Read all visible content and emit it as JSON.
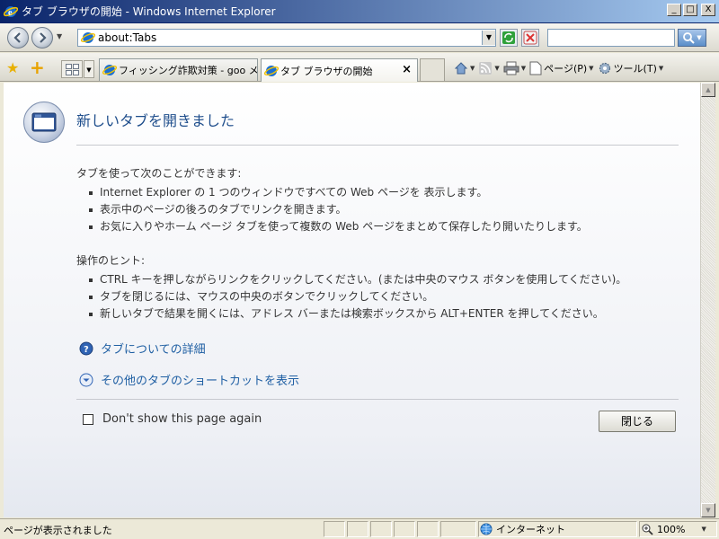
{
  "window": {
    "title": "タブ ブラウザの開始 - Windows Internet Explorer",
    "minimize": "_",
    "maximize": "□",
    "close": "X"
  },
  "address": {
    "url": "about:Tabs"
  },
  "tabs": [
    {
      "label": "フィッシング詐欺対策 - goo メ..."
    },
    {
      "label": "タブ ブラウザの開始",
      "close": "×"
    }
  ],
  "commandbar": {
    "page_label": "ページ(P)",
    "tools_label": "ツール(T)"
  },
  "content": {
    "heading": "新しいタブを開きました",
    "section1": {
      "title": "タブを使って次のことができます:",
      "items": [
        "Internet Explorer の 1 つのウィンドウですべての Web ページを 表示します。",
        "表示中のページの後ろのタブでリンクを開きます。",
        "お気に入りやホーム ページ タブを使って複数の Web ページをまとめて保存したり開いたりします。"
      ]
    },
    "section2": {
      "title": "操作のヒント:",
      "items": [
        "CTRL キーを押しながらリンクをクリックしてください。(または中央のマウス ボタンを使用してください)。",
        "タブを閉じるには、マウスの中央のボタンでクリックしてください。",
        "新しいタブで結果を開くには、アドレス バーまたは検索ボックスから ALT+ENTER を押してください。"
      ]
    },
    "link_details": "タブについての詳細",
    "link_shortcuts": "その他のタブのショートカットを表示",
    "dont_show": "Don't show this page again",
    "close_button": "閉じる"
  },
  "status": {
    "text": "ページが表示されました",
    "zone": "インターネット",
    "zoom": "100%"
  },
  "colors": {
    "heading": "#1f4e8c",
    "link": "#1f5fa3",
    "title_bar": "#0a246a"
  }
}
